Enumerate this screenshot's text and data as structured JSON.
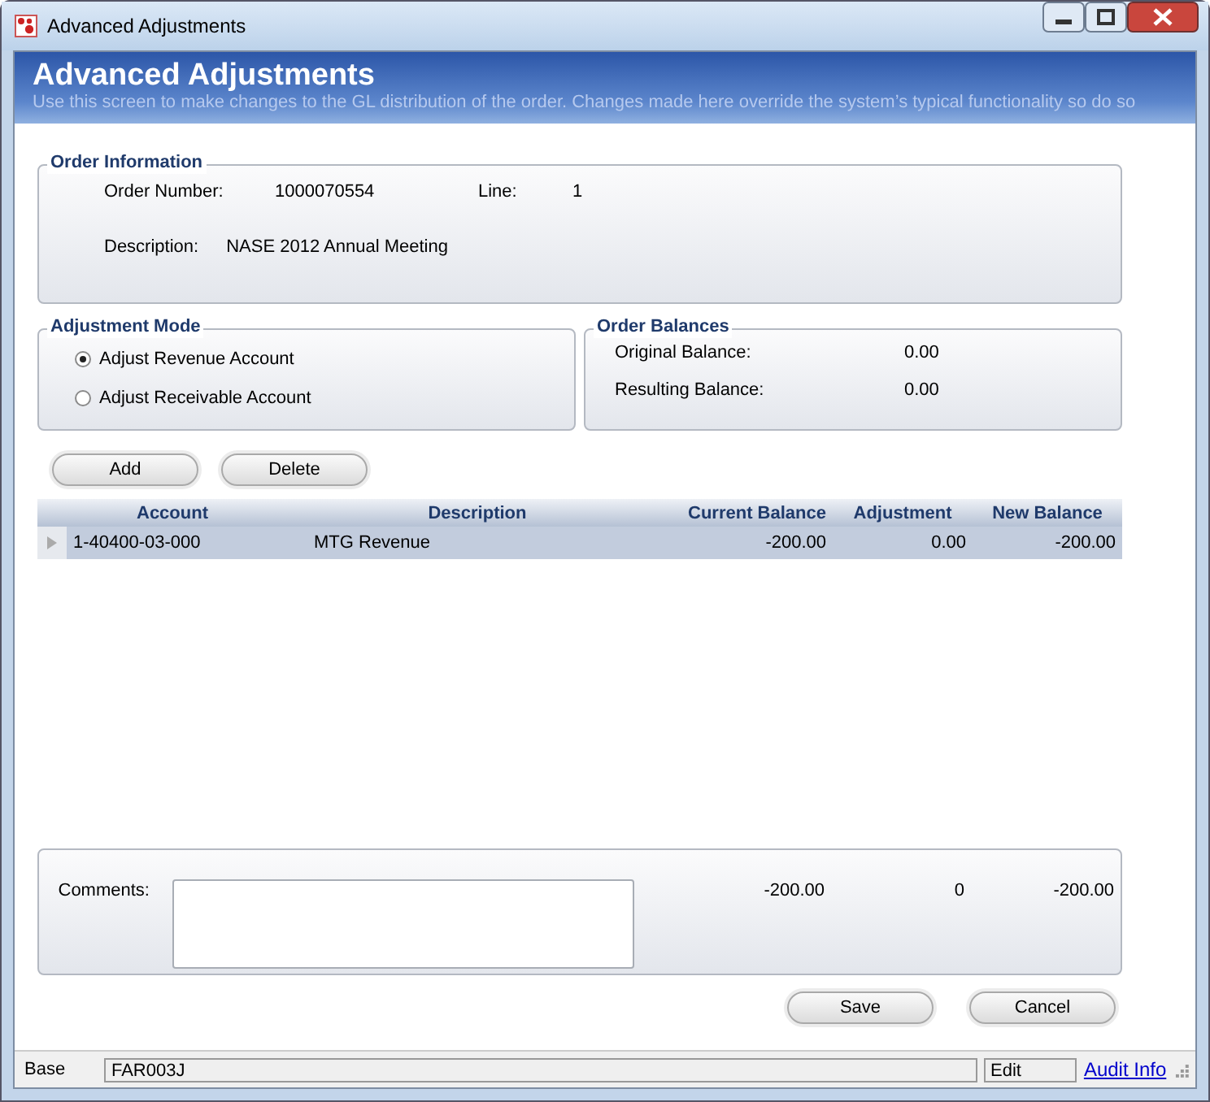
{
  "window": {
    "title": "Advanced Adjustments"
  },
  "header": {
    "title": "Advanced Adjustments",
    "subtitle": "Use this screen to make changes to the GL distribution of the order. Changes made here override the system’s typical functionality so do so"
  },
  "order_information": {
    "legend": "Order Information",
    "fields": [
      {
        "label": "Order Number:",
        "value": "1000070554"
      },
      {
        "label": "Line:",
        "value": "1"
      },
      {
        "label": "Description:",
        "value": "NASE 2012 Annual Meeting"
      }
    ]
  },
  "adjustment_mode": {
    "legend": "Adjustment Mode",
    "options": [
      {
        "label": "Adjust Revenue Account",
        "selected": true
      },
      {
        "label": "Adjust Receivable Account",
        "selected": false
      }
    ]
  },
  "order_balances": {
    "legend": "Order Balances",
    "rows": [
      {
        "label": "Original Balance:",
        "value": "0.00"
      },
      {
        "label": "Resulting Balance:",
        "value": "0.00"
      }
    ]
  },
  "toolbar": [
    "Add",
    "Delete"
  ],
  "table": {
    "columns": [
      "Account",
      "Description",
      "Current Balance",
      "Adjustment",
      "New Balance"
    ],
    "rows": [
      {
        "selected": true,
        "cells": [
          "1-40400-03-000",
          "MTG Revenue",
          "-200.00",
          "0.00",
          "-200.00"
        ]
      }
    ]
  },
  "totals": {
    "comments_label": "Comments:",
    "values": [
      "-200.00",
      "0",
      "-200.00"
    ]
  },
  "buttons": [
    "Save",
    "Cancel"
  ],
  "status_bar": {
    "mode": "Base",
    "code": "FAR003J",
    "state": "Edit",
    "link": "Audit Info"
  }
}
